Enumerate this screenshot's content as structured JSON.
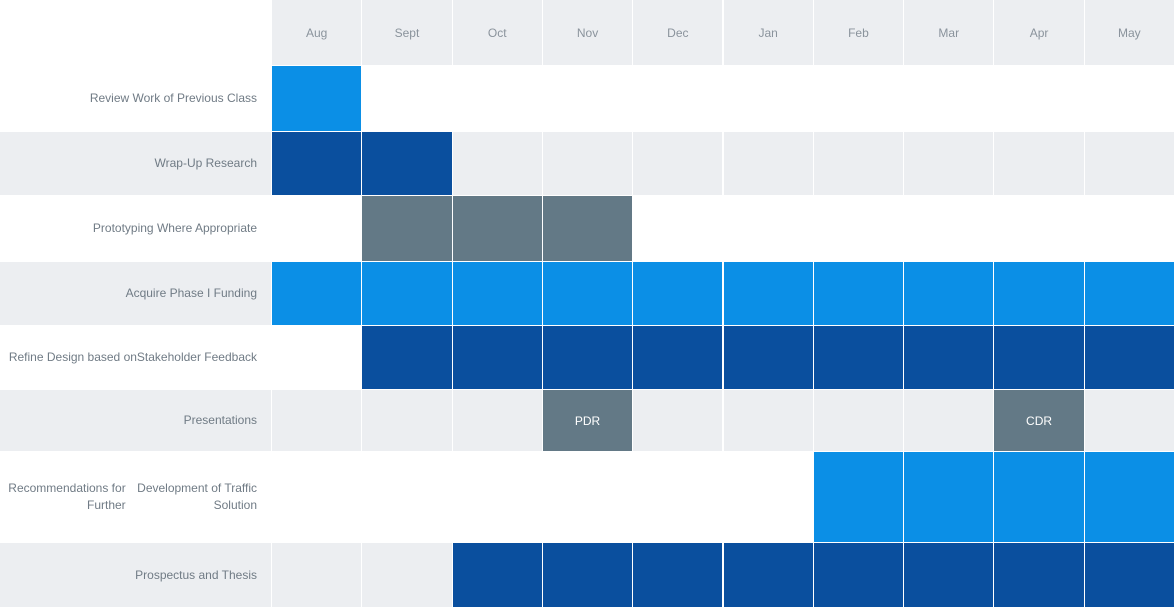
{
  "chart_data": {
    "type": "gantt",
    "months": [
      "Aug",
      "Sept",
      "Oct",
      "Nov",
      "Dec",
      "Jan",
      "Feb",
      "Mar",
      "Apr",
      "May"
    ],
    "tasks": [
      {
        "label": "Review Work of Previous Class",
        "start": 0,
        "end": 0,
        "color": "#0b8fe6",
        "stripe": false
      },
      {
        "label": "Wrap-Up Research",
        "start": 0,
        "end": 1,
        "color": "#0a4f9e",
        "stripe": true
      },
      {
        "label": "Prototyping Where Appropriate",
        "start": 1,
        "end": 3,
        "color": "#637986",
        "stripe": false
      },
      {
        "label": "Acquire Phase I Funding",
        "start": 0,
        "end": 9,
        "color": "#0b8fe6",
        "stripe": true
      },
      {
        "label": "Refine Design based on\nStakeholder Feedback",
        "start": 1,
        "end": 9,
        "color": "#0a4f9e",
        "stripe": false
      },
      {
        "label": "Presentations",
        "start": null,
        "end": null,
        "color": "#637986",
        "stripe": true,
        "milestones": [
          {
            "month": 3,
            "text": "PDR"
          },
          {
            "month": 8,
            "text": "CDR"
          }
        ]
      },
      {
        "label": "Recommendations for Further\nDevelopment of Traffic Solution",
        "start": 6,
        "end": 9,
        "color": "#0b8fe6",
        "stripe": false
      },
      {
        "label": "Prospectus and Thesis",
        "start": 2,
        "end": 9,
        "color": "#0a4f9e",
        "stripe": true
      }
    ]
  },
  "colors": {
    "stripe": "#eceef1",
    "grid_line": "#ffffff",
    "label_text": "#707b85",
    "header_text": "#8a939c",
    "milestone_text": "#ffffff"
  }
}
